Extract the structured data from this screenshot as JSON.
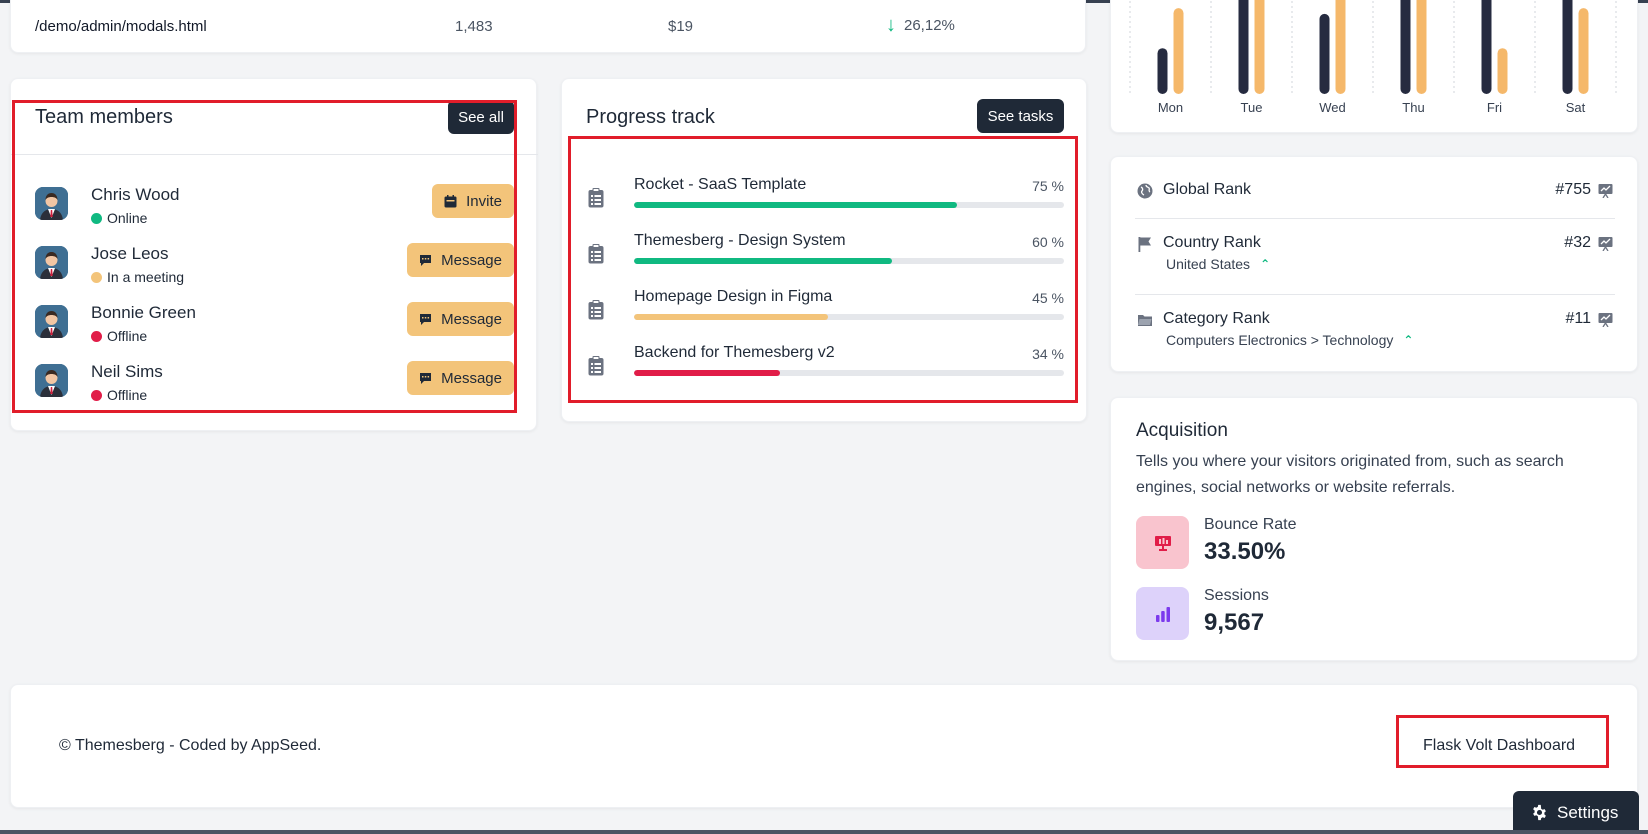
{
  "table_row": {
    "path": "/demo/admin/modals.html",
    "views": "1,483",
    "value": "$19",
    "bounce_rate": "26,12%"
  },
  "chart_data": {
    "type": "bar",
    "categories": [
      "Mon",
      "Tue",
      "Wed",
      "Thu",
      "Fri",
      "Sat"
    ],
    "series": [
      {
        "name": "",
        "color": "#262b40",
        "values": [
          4,
          9,
          7,
          9,
          9,
          9
        ]
      },
      {
        "name": "",
        "color": "#f5b86a",
        "values": [
          7.5,
          9,
          9,
          9,
          4,
          7.5
        ]
      }
    ],
    "ylim": [
      0,
      9
    ],
    "grid": true
  },
  "team": {
    "title": "Team members",
    "see_all": "See all",
    "members": [
      {
        "name": "Chris Wood",
        "status": "Online",
        "status_color": "#10b981",
        "action": "Invite",
        "action_icon": "calendar-icon"
      },
      {
        "name": "Jose Leos",
        "status": "In a meeting",
        "status_color": "#f3c47a",
        "action": "Message",
        "action_icon": "chat-icon"
      },
      {
        "name": "Bonnie Green",
        "status": "Offline",
        "status_color": "#e11d48",
        "action": "Message",
        "action_icon": "chat-icon"
      },
      {
        "name": "Neil Sims",
        "status": "Offline",
        "status_color": "#e11d48",
        "action": "Message",
        "action_icon": "chat-icon"
      }
    ]
  },
  "progress": {
    "title": "Progress track",
    "see_tasks": "See tasks",
    "tasks": [
      {
        "name": "Rocket - SaaS Template",
        "percent_label": "75 %",
        "percent": 75,
        "color": "#10b981"
      },
      {
        "name": "Themesberg - Design System",
        "percent_label": "60 %",
        "percent": 60,
        "color": "#10b981"
      },
      {
        "name": "Homepage Design in Figma",
        "percent_label": "45 %",
        "percent": 45,
        "color": "#f3c47a"
      },
      {
        "name": "Backend for Themesberg v2",
        "percent_label": "34 %",
        "percent": 34,
        "color": "#e11d48"
      }
    ]
  },
  "ranks": [
    {
      "label": "Global Rank",
      "sub": "",
      "value": "#755",
      "icon": "globe-icon"
    },
    {
      "label": "Country Rank",
      "sub": "United States",
      "value": "#32",
      "icon": "flag-icon"
    },
    {
      "label": "Category Rank",
      "sub": "Computers Electronics > Technology",
      "value": "#11",
      "icon": "folder-icon"
    }
  ],
  "acquisition": {
    "title": "Acquisition",
    "description": "Tells you where your visitors originated from, such as search engines, social networks or website referrals.",
    "metrics": [
      {
        "label": "Bounce Rate",
        "value": "33.50%",
        "bg": "#f9c4ce",
        "icon_color": "#e11d48"
      },
      {
        "label": "Sessions",
        "value": "9,567",
        "bg": "#ddd2fa",
        "icon_color": "#7c3aed"
      }
    ]
  },
  "footer": {
    "copyright": "© Themesberg - Coded by AppSeed.",
    "link": "Flask Volt Dashboard"
  },
  "settings": {
    "label": "Settings"
  }
}
